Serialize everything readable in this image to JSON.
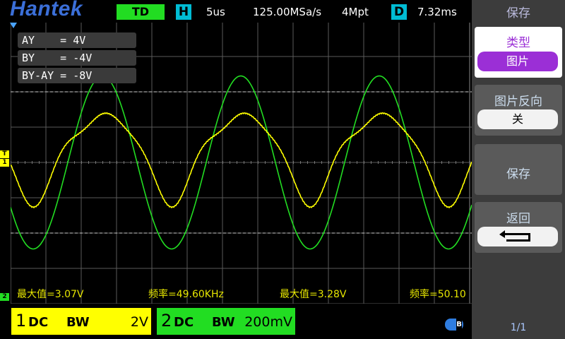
{
  "header": {
    "logo": "Hantek",
    "trigger_mode": "TD",
    "h_marker": "H",
    "timebase": "5us",
    "sample_rate": "125.00MSa/s",
    "memory_depth": "4Mpt",
    "d_marker": "D",
    "delay": "7.32ms"
  },
  "cursors": {
    "ay": "AY    = 4V",
    "by": "BY    = -4V",
    "diff": "BY-AY = -8V"
  },
  "markers": {
    "trigger": "T",
    "ch1": "1",
    "ch2": "2"
  },
  "measurements": [
    {
      "text": "最大值=3.07V",
      "color": "#e6e600"
    },
    {
      "text": "频率=49.60KHz",
      "color": "#e6e600"
    },
    {
      "text": "最大值=3.28V",
      "color": "#e6e600"
    },
    {
      "text": "频率=50.10",
      "color": "#e6e600"
    }
  ],
  "channels": {
    "ch1": {
      "num": "1",
      "coupling": "DC",
      "bw": "BW",
      "vdiv": "2V",
      "color": "#ffff00"
    },
    "ch2": {
      "num": "2",
      "coupling": "DC",
      "bw": "BW",
      "vdiv": "200mV",
      "color": "#22dd22"
    }
  },
  "menu": {
    "title": "保存",
    "type_label": "类型",
    "type_value": "图片",
    "orient_label": "图片反向",
    "orient_value": "关",
    "save_label": "保存",
    "back_label": "返回",
    "page": "1/1"
  },
  "colors": {
    "ch1": "#ffff00",
    "ch2": "#22dd22",
    "accent": "#9b2fd6",
    "logo": "#3b6fd8"
  },
  "waveforms": {
    "ch1": {
      "peak_div": 1.57,
      "label": "CH1 yellow distorted sine"
    },
    "ch2": {
      "peak_div": 2.45,
      "label": "CH2 green sine"
    }
  }
}
